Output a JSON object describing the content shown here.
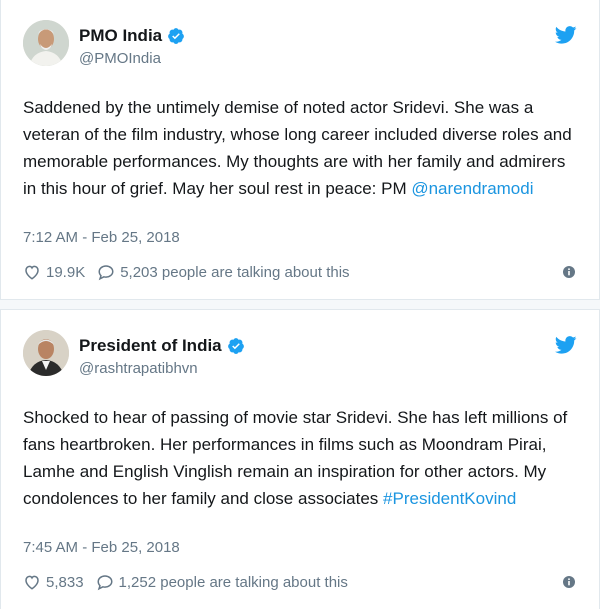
{
  "tweets": [
    {
      "display_name": "PMO India",
      "handle": "@PMOIndia",
      "text_prefix": "Saddened by the untimely demise of noted actor Sridevi. She was a veteran of the film industry, whose long career included diverse roles and memorable performances. My thoughts are with her family and admirers in this hour of grief. May her soul rest in peace: PM ",
      "text_link": "@narendramodi",
      "timestamp": "7:12 AM - Feb 25, 2018",
      "likes": "19.9K",
      "talking": "5,203 people are talking about this"
    },
    {
      "display_name": "President of India",
      "handle": "@rashtrapatibhvn",
      "text_prefix": "Shocked to hear of passing of movie star Sridevi. She has left millions of fans heartbroken. Her performances in films such as Moondram Pirai, Lamhe and English Vinglish remain an inspiration for other actors. My condolences to her family and close associates ",
      "text_link": "#PresidentKovind",
      "timestamp": "7:45 AM - Feb 25, 2018",
      "likes": "5,833",
      "talking": "1,252 people are talking about this"
    }
  ],
  "colors": {
    "link": "#1b95e0",
    "muted": "#657786",
    "verified": "#1da1f2",
    "twitter_blue": "#1da1f2"
  },
  "icons": [
    "twitter-bird-icon",
    "verified-badge-icon",
    "heart-icon",
    "reply-bubble-icon",
    "info-icon"
  ]
}
